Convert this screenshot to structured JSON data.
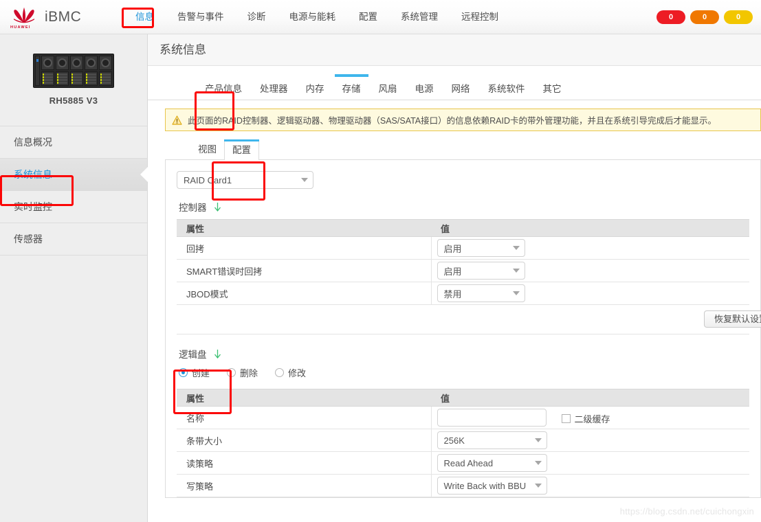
{
  "header": {
    "brand": "iBMC",
    "logo_word": "HUAWEI",
    "nav": [
      {
        "label": "信息",
        "active": true
      },
      {
        "label": "告警与事件",
        "active": false
      },
      {
        "label": "诊断",
        "active": false
      },
      {
        "label": "电源与能耗",
        "active": false
      },
      {
        "label": "配置",
        "active": false
      },
      {
        "label": "系统管理",
        "active": false
      },
      {
        "label": "远程控制",
        "active": false
      }
    ],
    "badges": [
      {
        "name": "critical-alarm-badge",
        "value": "0",
        "color": "#ed1c24"
      },
      {
        "name": "major-alarm-badge",
        "value": "0",
        "color": "#f07800"
      },
      {
        "name": "minor-alarm-badge",
        "value": "0",
        "color": "#f2c600"
      }
    ]
  },
  "sidebar": {
    "server_model": "RH5885 V3",
    "items": [
      {
        "label": "信息概况",
        "active": false
      },
      {
        "label": "系统信息",
        "active": true
      },
      {
        "label": "实时监控",
        "active": false
      },
      {
        "label": "传感器",
        "active": false
      }
    ]
  },
  "main": {
    "page_title": "系统信息",
    "tabs": [
      {
        "label": "产品信息",
        "active": false
      },
      {
        "label": "处理器",
        "active": false
      },
      {
        "label": "内存",
        "active": false
      },
      {
        "label": "存储",
        "active": true
      },
      {
        "label": "风扇",
        "active": false
      },
      {
        "label": "电源",
        "active": false
      },
      {
        "label": "网络",
        "active": false
      },
      {
        "label": "系统软件",
        "active": false
      },
      {
        "label": "其它",
        "active": false
      }
    ],
    "warning": "此页面的RAID控制器、逻辑驱动器、物理驱动器（SAS/SATA接口）的信息依赖RAID卡的带外管理功能，并且在系统引导完成后才能显示。",
    "subtabs": [
      {
        "label": "视图",
        "active": false
      },
      {
        "label": "配置",
        "active": true
      }
    ],
    "raid_card_select": "RAID Card1",
    "controller": {
      "section_label": "控制器",
      "columns": [
        "属性",
        "值"
      ],
      "rows": [
        {
          "attr": "回拷",
          "value": "启用"
        },
        {
          "attr": "SMART错误时回拷",
          "value": "启用"
        },
        {
          "attr": "JBOD模式",
          "value": "禁用"
        }
      ],
      "restore_button": "恢复默认设置"
    },
    "logical_disk": {
      "section_label": "逻辑盘",
      "options": [
        {
          "label": "创建",
          "selected": true
        },
        {
          "label": "删除",
          "selected": false
        },
        {
          "label": "修改",
          "selected": false
        }
      ],
      "columns": [
        "属性",
        "值"
      ],
      "rows": [
        {
          "attr": "名称",
          "value": "",
          "type": "input",
          "checkbox_label": "二级缓存",
          "checked": false
        },
        {
          "attr": "条带大小",
          "value": "256K",
          "type": "select"
        },
        {
          "attr": "读策略",
          "value": "Read Ahead",
          "type": "select"
        },
        {
          "attr": "写策略",
          "value": "Write Back with BBU",
          "type": "select"
        }
      ]
    }
  },
  "watermark": "https://blog.csdn.net/cuichongxin"
}
